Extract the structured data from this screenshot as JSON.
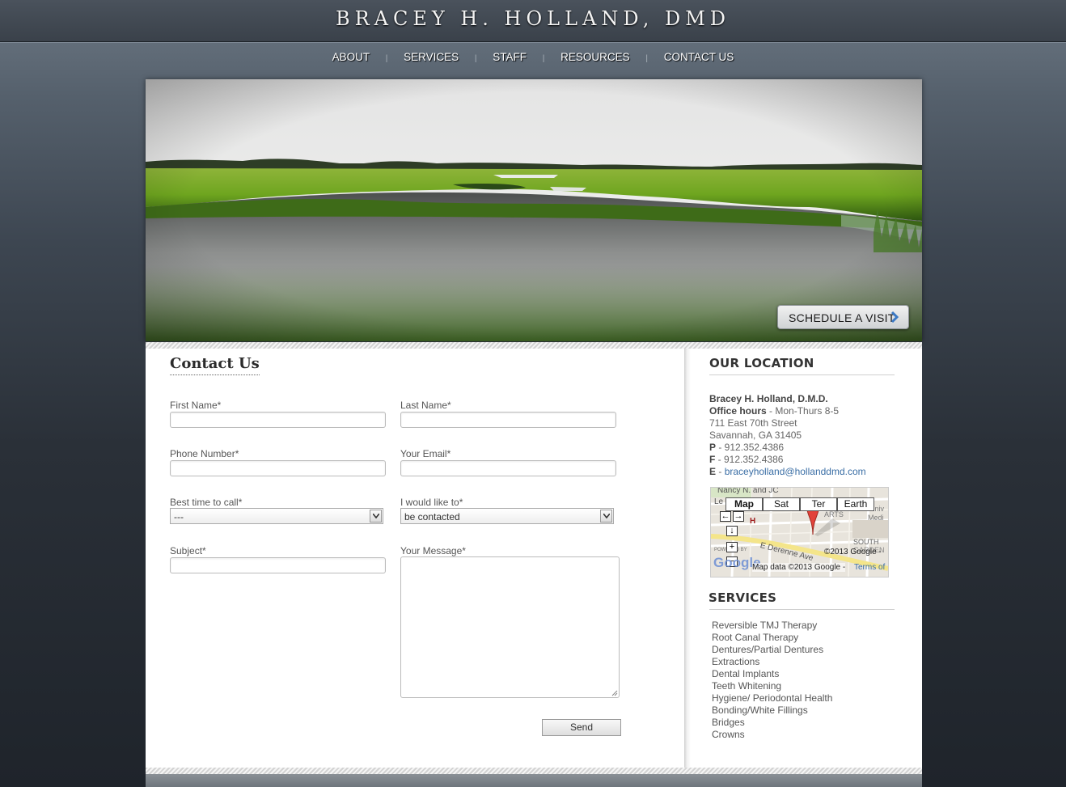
{
  "site": {
    "title": "BRACEY H. HOLLAND, DMD"
  },
  "nav": {
    "items": [
      "ABOUT",
      "SERVICES",
      "STAFF",
      "RESOURCES",
      "CONTACT US"
    ],
    "separator": "|"
  },
  "hero": {
    "cta_label": "SCHEDULE A VISIT"
  },
  "contact": {
    "title": "Contact Us",
    "first_name_label": "First Name*",
    "last_name_label": "Last Name*",
    "phone_label": "Phone Number*",
    "email_label": "Your Email*",
    "best_time_label": "Best time to call*",
    "best_time_value": "---",
    "would_like_label": "I would like to*",
    "would_like_value": "be contacted",
    "subject_label": "Subject*",
    "message_label": "Your Message*",
    "send_label": "Send"
  },
  "location": {
    "heading": "OUR LOCATION",
    "name": "Bracey H. Holland, D.M.D.",
    "hours_label": "Office hours",
    "hours_value": " - Mon-Thurs 8-5",
    "street": "711 East 70th Street",
    "city": "Savannah, GA 31405",
    "phone_label": "P",
    "phone_value": " - 912.352.4386",
    "fax_label": "F",
    "fax_value": " - 912.352.4386",
    "email_label": "E",
    "email_sep": " - ",
    "email_value": "braceyholland@hollanddmd.com"
  },
  "map": {
    "tabs": [
      "Map",
      "Sat",
      "Ter",
      "Earth"
    ],
    "active_tab": "Map",
    "labels": {
      "top": "Nancy N. and JC",
      "left": "Le",
      "arts": "ARTS",
      "medi": "Medi",
      "univ": "Univ",
      "south": "SOUTH",
      "garden": "GARDEN",
      "street": "E Derenne Ave",
      "powered": "POWERED BY",
      "h": "H"
    },
    "copyright": "©2013 Google -",
    "data_text": "Map data ©2013 Google -",
    "terms": "Terms of"
  },
  "services": {
    "heading": "SERVICES",
    "items": [
      "Reversible TMJ Therapy",
      "Root Canal Therapy",
      "Dentures/Partial Dentures",
      "Extractions",
      "Dental Implants",
      "Teeth Whitening",
      "Hygiene/ Periodontal Health",
      "Bonding/White Fillings",
      "Bridges",
      "Crowns"
    ]
  },
  "colors": {
    "accent_link": "#3a6ea5",
    "page_dark": "#1f242b",
    "panel": "#ffffff"
  }
}
